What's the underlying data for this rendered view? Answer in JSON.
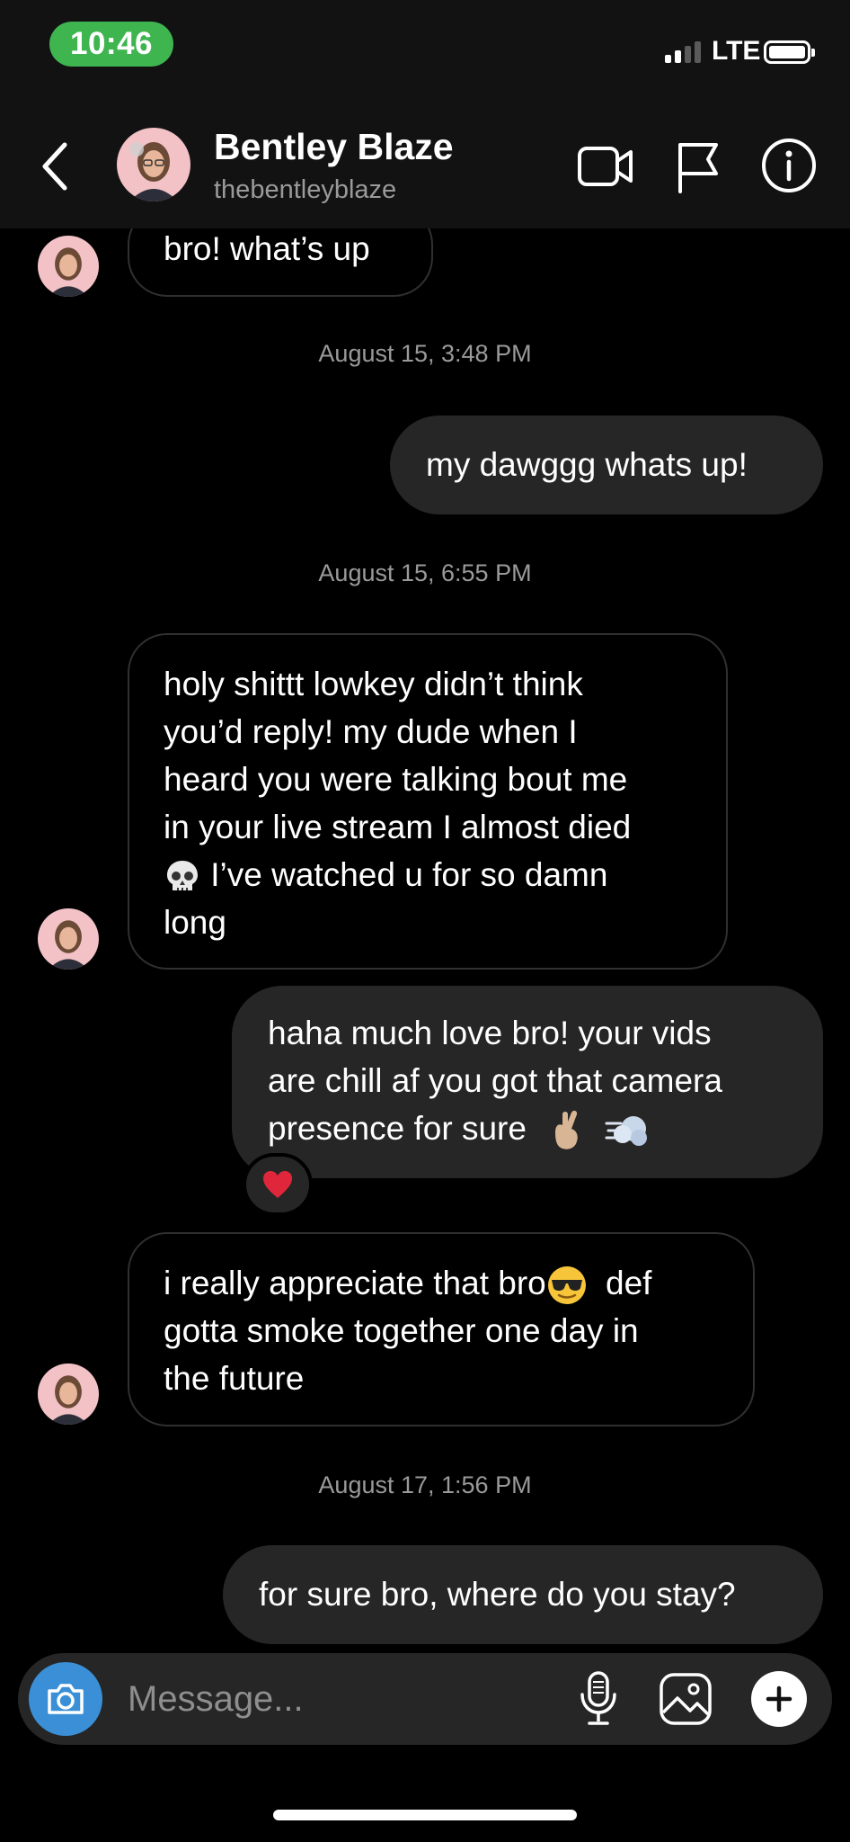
{
  "status_bar": {
    "time": "10:46",
    "network": "LTE"
  },
  "header": {
    "name": "Bentley Blaze",
    "handle": "thebentleyblaze"
  },
  "messages": {
    "m1": "bro! what’s up",
    "ts1": "August 15, 3:48 PM",
    "m2": "my dawggg whats up!",
    "ts2": "August 15, 6:55 PM",
    "m3": [
      "holy shittt lowkey didn’t think",
      "you’d reply! my dude when I",
      "heard you were talking bout me",
      "in your live stream I almost died",
      "I’ve watched u for so damn",
      "long"
    ],
    "m4": [
      "haha much love bro! your vids",
      "are chill af you got that camera",
      "presence for sure"
    ],
    "m5": [
      "i really appreciate that bro",
      "def",
      "gotta smoke together one day in",
      "the future"
    ],
    "ts3": "August 17, 1:56 PM",
    "m6": "for sure bro, where do you stay?"
  },
  "composer": {
    "placeholder": "Message..."
  },
  "colors": {
    "time_pill": "#3fb550",
    "camera_button": "#3a8fd6",
    "outgoing_bubble": "#262626",
    "header_bg": "#121212"
  },
  "icons": [
    "chevron-left-icon",
    "video-camera-icon",
    "flag-icon",
    "info-icon",
    "camera-icon",
    "microphone-icon",
    "gallery-icon",
    "plus-icon",
    "heart-icon",
    "skull-emoji",
    "crossed-fingers-emoji",
    "dash-emoji",
    "sunglasses-emoji"
  ]
}
